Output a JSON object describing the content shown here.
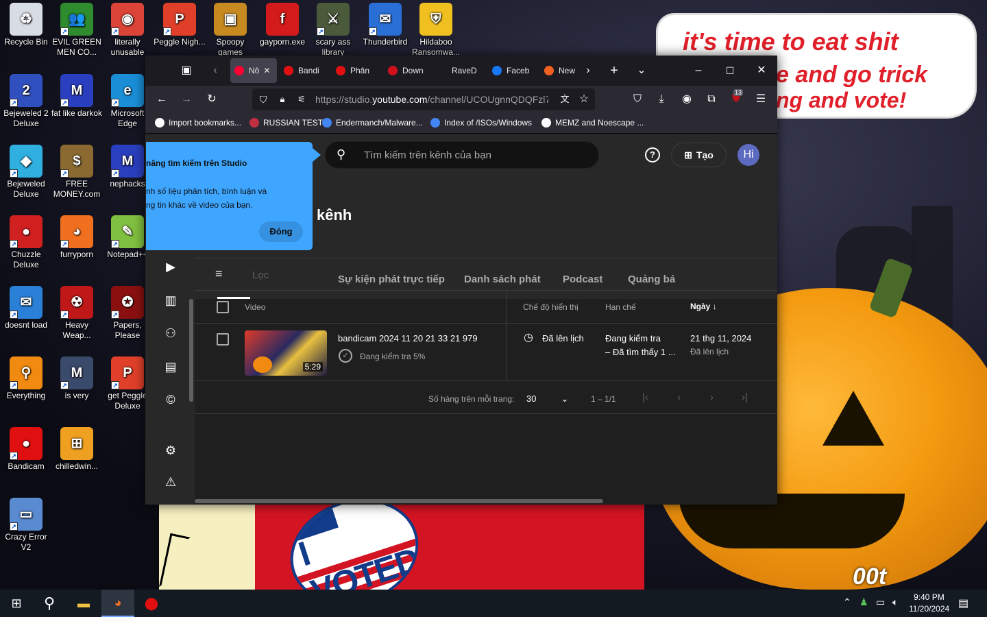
{
  "wallpaper": {
    "speech_lines": [
      "it's time to eat shit",
      "e and go trick",
      "ng and vote!"
    ],
    "poster_text": "I VOTED",
    "corner_text": "00t"
  },
  "desktop_icons": [
    {
      "label": "Recycle Bin",
      "color": "#d8dce4",
      "glyph": "♻",
      "shortcut": false
    },
    {
      "label": "EVIL GREEN MEN CO...",
      "color": "#2e8b2e",
      "glyph": "👥",
      "shortcut": true
    },
    {
      "label": "literally unusable",
      "color": "#db4437",
      "glyph": "◉",
      "shortcut": true
    },
    {
      "label": "Peggle Nigh...",
      "color": "#e0402a",
      "glyph": "P",
      "shortcut": true
    },
    {
      "label": "Spoopy games",
      "color": "#c78a20",
      "glyph": "▣",
      "shortcut": false
    },
    {
      "label": "gayporn.exe",
      "color": "#d41b1b",
      "glyph": "f",
      "shortcut": false
    },
    {
      "label": "scary ass library",
      "color": "#4a5a3a",
      "glyph": "⚔",
      "shortcut": true
    },
    {
      "label": "Thunderbird",
      "color": "#2a6fd6",
      "glyph": "✉",
      "shortcut": true
    },
    {
      "label": "Hildaboo Ransomwa...",
      "color": "#f0c020",
      "glyph": "⛨",
      "shortcut": false
    },
    {
      "label": "Bejeweled 2 Deluxe",
      "color": "#3050c0",
      "glyph": "2",
      "shortcut": true
    },
    {
      "label": "fat like darkok",
      "color": "#2a3fbf",
      "glyph": "M",
      "shortcut": true
    },
    {
      "label": "Microsoft Edge",
      "color": "#1a8fd8",
      "glyph": "e",
      "shortcut": true
    },
    {
      "label": "Bejeweled Deluxe",
      "color": "#30b0e0",
      "glyph": "◆",
      "shortcut": true
    },
    {
      "label": "FREE MONEY.com",
      "color": "#8a6a30",
      "glyph": "$",
      "shortcut": true
    },
    {
      "label": "nephacks",
      "color": "#2a3fbf",
      "glyph": "M",
      "shortcut": true
    },
    {
      "label": "Chuzzle Deluxe",
      "color": "#d02020",
      "glyph": "●",
      "shortcut": true
    },
    {
      "label": "furryporn",
      "color": "#f07020",
      "glyph": "◕",
      "shortcut": true
    },
    {
      "label": "Notepad++",
      "color": "#80c040",
      "glyph": "✎",
      "shortcut": true
    },
    {
      "label": "doesnt load",
      "color": "#2a7fd6",
      "glyph": "✉",
      "shortcut": true
    },
    {
      "label": "Heavy Weap...",
      "color": "#c01818",
      "glyph": "☢",
      "shortcut": true
    },
    {
      "label": "Papers, Please",
      "color": "#8a1010",
      "glyph": "✪",
      "shortcut": true
    },
    {
      "label": "Everything",
      "color": "#f08a10",
      "glyph": "⚲",
      "shortcut": true
    },
    {
      "label": "is very",
      "color": "#3a4a6a",
      "glyph": "M",
      "shortcut": true
    },
    {
      "label": "get Peggle Deluxe",
      "color": "#e0402a",
      "glyph": "P",
      "shortcut": true
    },
    {
      "label": "Bandicam",
      "color": "#e01010",
      "glyph": "●",
      "shortcut": true
    },
    {
      "label": "chilledwin...",
      "color": "#f0a020",
      "glyph": "⊞",
      "shortcut": false
    },
    {
      "label": "Crazy Error V2",
      "color": "#5a8ad0",
      "glyph": "▭",
      "shortcut": true
    }
  ],
  "browser": {
    "tabs": [
      {
        "label": "Nô",
        "color": "#ff0033",
        "active": true
      },
      {
        "label": "Bandi",
        "color": "#e01010",
        "active": false
      },
      {
        "label": "Phân",
        "color": "#e01010",
        "active": false
      },
      {
        "label": "Down",
        "color": "#d0101a",
        "active": false
      },
      {
        "label": "RaveD",
        "color": "#1c1b22",
        "active": false
      },
      {
        "label": "Faceb",
        "color": "#1877f2",
        "active": false
      },
      {
        "label": "New",
        "color": "#f06020",
        "active": false
      }
    ],
    "url_prefix": "https://studio.",
    "url_domain": "youtube.com",
    "url_rest": "/channel/UCOUgnnQDQFzl7",
    "extension_badge": "13",
    "bookmarks": [
      {
        "label": "Import bookmarks...",
        "icon": "import-icon",
        "color": "#fbfbfe"
      },
      {
        "label": "RUSSIAN TEST",
        "icon": "github-icon",
        "color": "#c03040"
      },
      {
        "label": "Endermanch/Malware...",
        "icon": "google-icon",
        "color": "#4285f4"
      },
      {
        "label": "Index of /ISOs/Windows",
        "icon": "google-icon",
        "color": "#4285f4"
      },
      {
        "label": "MEMZ and Noescape ...",
        "icon": "globe-icon",
        "color": "#fbfbfe"
      }
    ]
  },
  "studio": {
    "search_placeholder": "Tìm kiếm trên kênh của bạn",
    "create_label": "Tạo",
    "avatar_text": "Hi",
    "page_title": "kênh",
    "tabs": [
      "Sự kiện phát trực tiếp",
      "Danh sách phát",
      "Podcast",
      "Quảng bá"
    ],
    "filter_label": "Lọc",
    "columns": {
      "video": "Video",
      "visibility": "Chế độ hiển thị",
      "restrictions": "Hạn chế",
      "date": "Ngày"
    },
    "rows": [
      {
        "title": "bandicam 2024 11 20 21 33 21 979",
        "check_status": "Đang kiểm tra 5%",
        "duration": "5:29",
        "visibility": "Đã lên lịch",
        "restriction_line1": "Đang kiểm tra",
        "restriction_line2": "– Đã tìm thấy 1 ...",
        "date": "21 thg 11, 2024",
        "date_sub": "Đã lên lịch"
      }
    ],
    "rows_per_page_label": "Số hàng trên mỗi trang:",
    "rows_per_page": "30",
    "range": "1 – 1/1",
    "popup_title": "năng tìm kiếm trên Studio",
    "popup_body": "nh số liệu phân tích, bình luận và\nng tin khác về video của bạn.",
    "popup_button": "Đóng"
  },
  "taskbar": {
    "time": "9:40 PM",
    "date": "11/20/2024"
  }
}
